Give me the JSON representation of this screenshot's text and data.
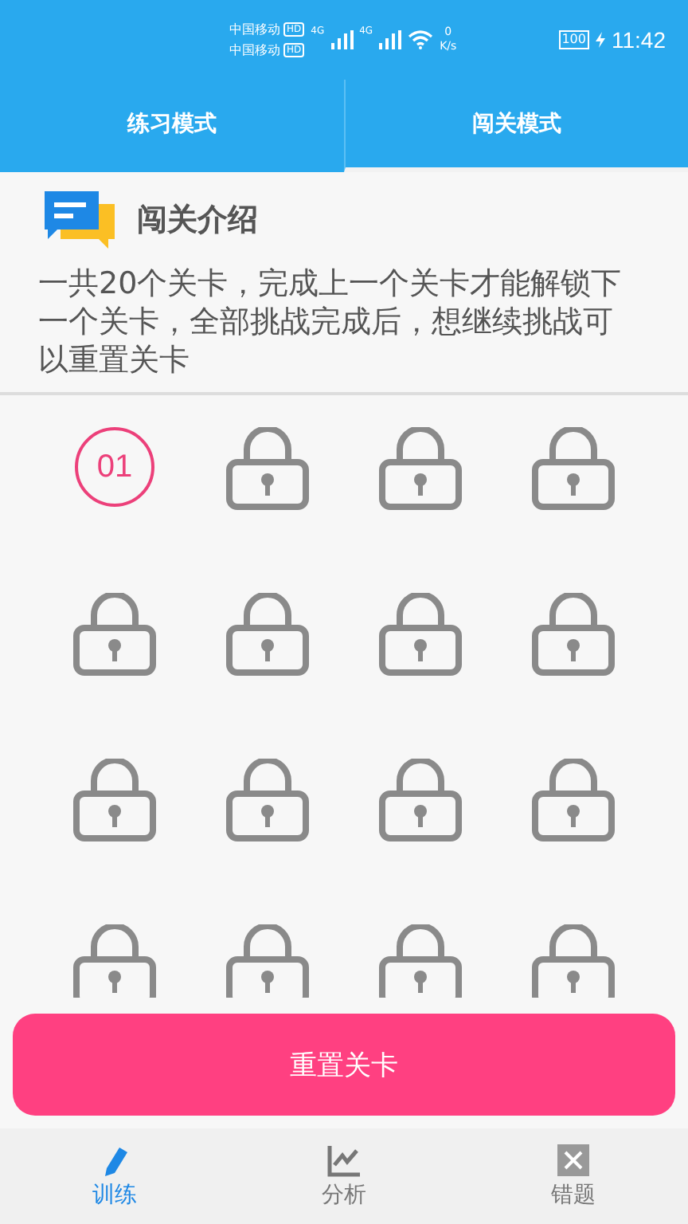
{
  "status_bar": {
    "carriers": [
      {
        "name": "中国移动",
        "badge": "HD"
      },
      {
        "name": "中国移动",
        "badge": "HD"
      }
    ],
    "network": [
      "4G",
      "4G"
    ],
    "speed_value": "0",
    "speed_unit": "K/s",
    "battery": "100",
    "time": "11:42"
  },
  "tabs": [
    {
      "label": "练习模式",
      "selected": false
    },
    {
      "label": "闯关模式",
      "selected": true
    }
  ],
  "intro": {
    "title": "闯关介绍",
    "text": "一共20个关卡，完成上一个关卡才能解锁下一个关卡，全部挑战完成后，想继续挑战可以重置关卡"
  },
  "levels": [
    {
      "kind": "unlocked",
      "label": "01"
    },
    {
      "kind": "locked"
    },
    {
      "kind": "locked"
    },
    {
      "kind": "locked"
    },
    {
      "kind": "locked"
    },
    {
      "kind": "locked"
    },
    {
      "kind": "locked"
    },
    {
      "kind": "locked"
    },
    {
      "kind": "locked"
    },
    {
      "kind": "locked"
    },
    {
      "kind": "locked"
    },
    {
      "kind": "locked"
    },
    {
      "kind": "locked"
    },
    {
      "kind": "locked"
    },
    {
      "kind": "locked"
    },
    {
      "kind": "locked"
    }
  ],
  "reset_button": "重置关卡",
  "bottom_nav": [
    {
      "label": "训练",
      "kind": "train",
      "selected": true
    },
    {
      "label": "分析",
      "kind": "analysis",
      "selected": false
    },
    {
      "label": "错题",
      "kind": "mistakes",
      "selected": false
    }
  ]
}
